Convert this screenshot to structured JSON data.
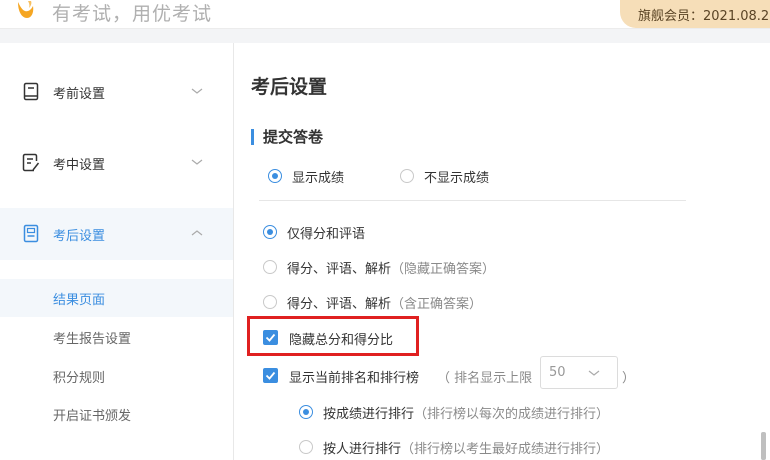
{
  "header": {
    "slogan": "有考试，用优考试",
    "member_badge": "旗舰会员：2021.08.2"
  },
  "sidebar": {
    "items": [
      {
        "label": "考前设置",
        "icon": "book-icon",
        "expanded": false
      },
      {
        "label": "考中设置",
        "icon": "edit-document-icon",
        "expanded": false
      },
      {
        "label": "考后设置",
        "icon": "report-document-icon",
        "expanded": true
      }
    ],
    "subitems": [
      {
        "label": "结果页面",
        "active": true
      },
      {
        "label": "考生报告设置",
        "active": false
      },
      {
        "label": "积分规则",
        "active": false
      },
      {
        "label": "开启证书颁发",
        "active": false
      }
    ]
  },
  "main": {
    "title": "考后设置",
    "section_title": "提交答卷",
    "score_display": {
      "options": [
        "显示成绩",
        "不显示成绩"
      ],
      "selected": "显示成绩"
    },
    "detail_options": [
      {
        "label": "仅得分和评语",
        "hint": "",
        "selected": true
      },
      {
        "label": "得分、评语、解析",
        "hint": "（隐藏正确答案）",
        "selected": false
      },
      {
        "label": "得分、评语、解析",
        "hint": "（含正确答案）",
        "selected": false
      }
    ],
    "hide_total": {
      "label": "隐藏总分和得分比",
      "checked": true
    },
    "show_rank": {
      "label": "显示当前排名和排行榜",
      "limit_prefix": "（ 排名显示上限",
      "limit_value": "50",
      "limit_suffix": "）",
      "checked": true
    },
    "rank_modes": [
      {
        "label": "按成绩进行排行",
        "hint": "（排行榜以每次的成绩进行排行）",
        "selected": true
      },
      {
        "label": "按人进行排行",
        "hint": "（排行榜以考生最好成绩进行排行）",
        "selected": false
      }
    ]
  },
  "colors": {
    "accent": "#3b8ee0",
    "highlight_box": "#e02020",
    "member_badge_bg": "#f6deb8",
    "logo": "#f5a623"
  }
}
